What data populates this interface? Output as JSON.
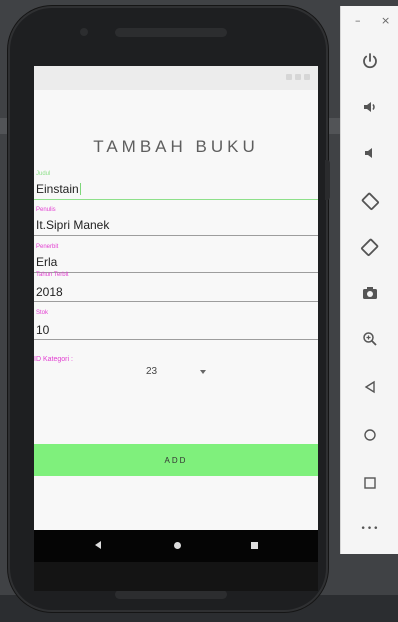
{
  "app": {
    "title": "TAMBAH BUKU",
    "fields": [
      {
        "label": "Judul",
        "value": "Einstain",
        "focused": true
      },
      {
        "label": "Penulis",
        "value": "It.Sipri Manek",
        "focused": false
      },
      {
        "label": "Penerbit",
        "value": "Erla",
        "focused": false
      },
      {
        "label": "Tahun Terbit",
        "value": "2018",
        "focused": false
      },
      {
        "label": "Stok",
        "value": "10",
        "focused": false
      }
    ],
    "kategori_label": "ID Kategori :",
    "kategori_value": "23",
    "add_label": "ADD"
  },
  "toolbar": {
    "minimize": "–",
    "close": "×",
    "more": "•••",
    "icons": [
      "power-icon",
      "volume-up-icon",
      "volume-down-icon",
      "rotate-left-icon",
      "rotate-right-icon",
      "camera-icon",
      "zoom-icon",
      "back-icon",
      "home-icon",
      "overview-icon",
      "more-icon"
    ]
  },
  "colors": {
    "accent_green": "#7ff07c",
    "label_pink": "#e23ed1",
    "focus_green": "#8ee08a"
  }
}
